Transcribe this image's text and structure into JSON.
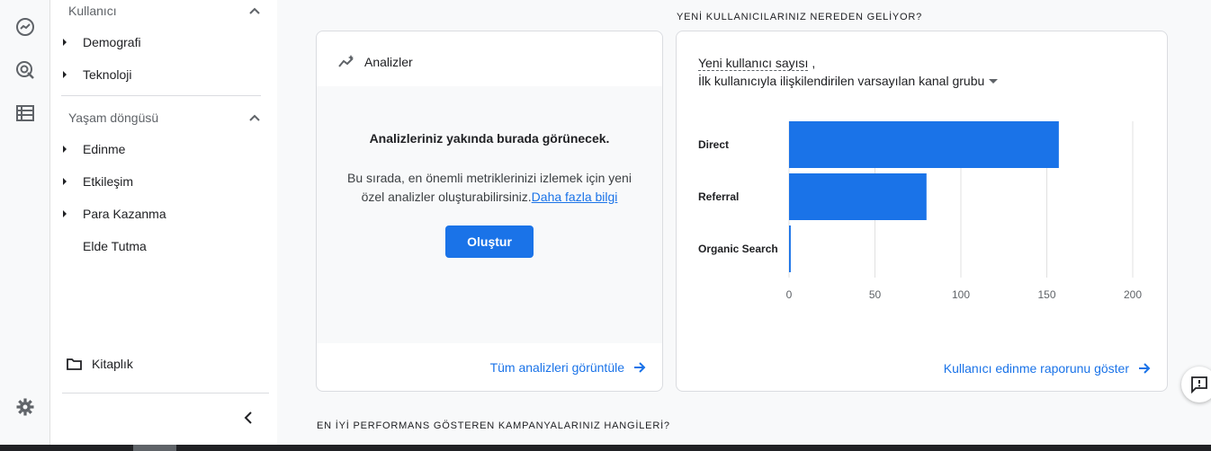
{
  "nav": {
    "section_user": "Kullanıcı",
    "user_items": [
      "Demografi",
      "Teknoloji"
    ],
    "section_lifecycle": "Yaşam döngüsü",
    "lifecycle_items": [
      "Edinme",
      "Etkileşim",
      "Para Kazanma",
      "Elde Tutma"
    ],
    "library": "Kitaplık"
  },
  "analytics_card": {
    "title": "Analizler",
    "headline": "Analizleriniz yakında burada görünecek.",
    "body_line1": "Bu sırada, en önemli metriklerinizi izlemek için yeni",
    "body_line2_prefix": "özel analizler oluşturabilirsiniz.",
    "learn_more": "Daha fazla bilgi",
    "create_button": "Oluştur",
    "footer_link": "Tüm analizleri görüntüle"
  },
  "acquisition": {
    "section_title": "YENİ KULLANICILARINIZ NEREDEN GELİYOR?",
    "metric_label": "Yeni kullanıcı sayısı",
    "metric_suffix": " ,",
    "dimension_label": "İlk kullanıcıyla ilişkilendirilen varsayılan kanal grubu",
    "footer_link": "Kullanıcı edinme raporunu göster"
  },
  "campaigns": {
    "section_title": "EN İYİ PERFORMANS GÖSTEREN KAMPANYALARINIZ HANGİLERİ?"
  },
  "colors": {
    "accent": "#1a73e8",
    "bar": "#1a73e8"
  },
  "chart_data": {
    "type": "bar",
    "orientation": "horizontal",
    "categories": [
      "Direct",
      "Referral",
      "Organic Search"
    ],
    "values": [
      157,
      80,
      1
    ],
    "xlim": [
      0,
      200
    ],
    "xticks": [
      0,
      50,
      100,
      150,
      200
    ],
    "grid": true
  }
}
